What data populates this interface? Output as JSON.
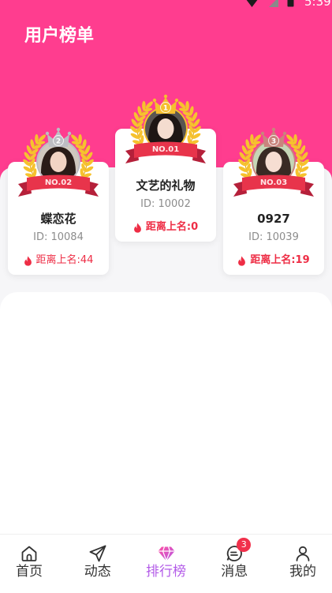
{
  "status_bar": {
    "time": "5:39",
    "icons": [
      "wifi-icon",
      "signal-icon",
      "battery-icon"
    ]
  },
  "header": {
    "title": "用户榜单"
  },
  "podium": [
    {
      "rank": "2",
      "badge": "NO.02",
      "name": "蝶恋花",
      "id": "ID: 10084",
      "distance": "距离上名:44",
      "crown_color": "#BDBDC3"
    },
    {
      "rank": "1",
      "badge": "NO.01",
      "name": "文艺的礼物",
      "id": "ID: 10002",
      "distance": "距离上名:0",
      "crown_color": "#F5BF2E"
    },
    {
      "rank": "3",
      "badge": "NO.03",
      "name": "0927",
      "id": "ID: 10039",
      "distance": "距离上名:19",
      "crown_color": "#C9847D"
    }
  ],
  "bottom_nav": {
    "items": [
      {
        "label": "首页",
        "icon": "home-icon",
        "active": false
      },
      {
        "label": "动态",
        "icon": "paper-plane-icon",
        "active": false
      },
      {
        "label": "排行榜",
        "icon": "diamond-icon",
        "active": true
      },
      {
        "label": "消息",
        "icon": "message-icon",
        "active": false,
        "badge": "3"
      },
      {
        "label": "我的",
        "icon": "person-icon",
        "active": false
      }
    ]
  },
  "colors": {
    "header_pink": "#FF3D8F",
    "distance_red": "#EE2D45",
    "active_tab": "#B35BE8",
    "badge_red": "#F1304B",
    "ribbon_red": "#E8344B"
  }
}
